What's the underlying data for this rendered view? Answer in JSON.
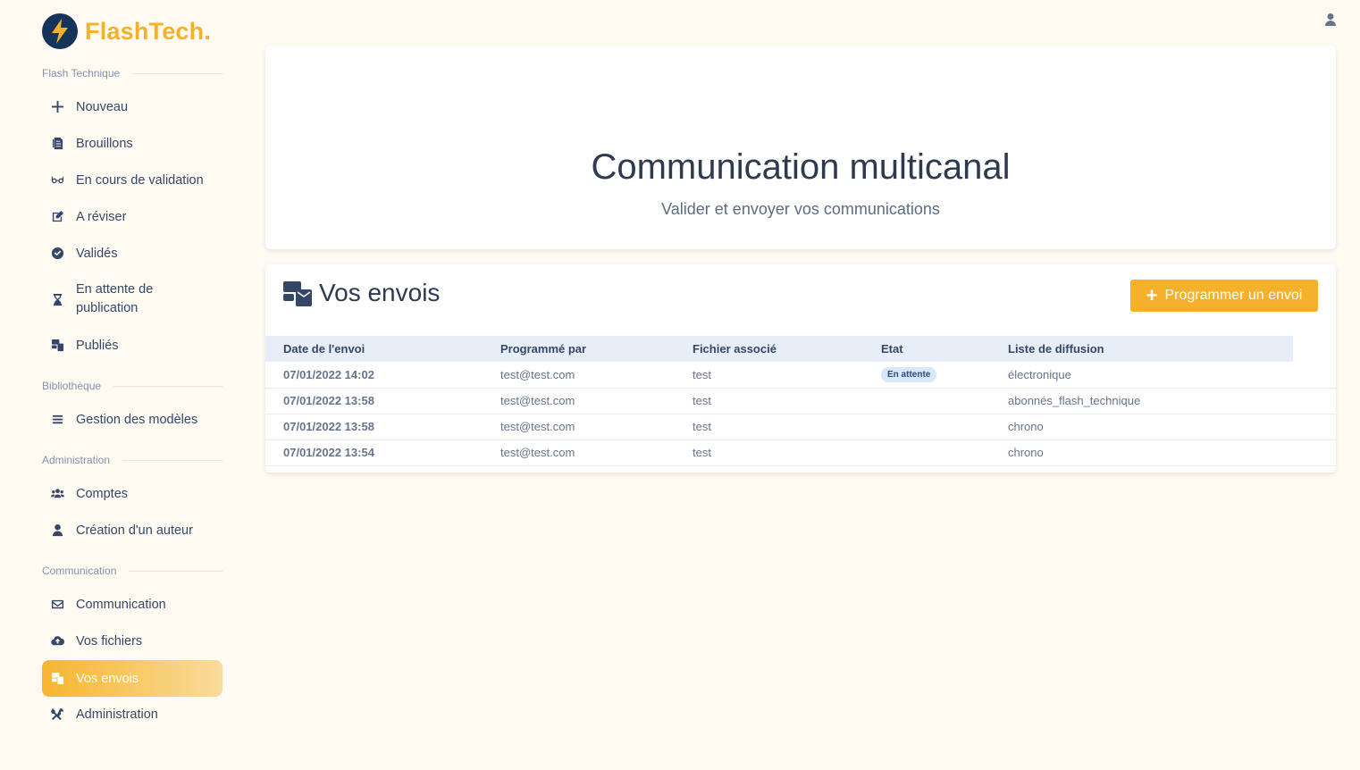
{
  "brand": {
    "name": "FlashTech."
  },
  "sidebar": {
    "sections": [
      {
        "title": "Flash Technique"
      },
      {
        "title": "Bibliothèque"
      },
      {
        "title": "Administration"
      },
      {
        "title": "Communication"
      }
    ],
    "items": [
      {
        "label": "Nouveau",
        "icon": "plus-icon"
      },
      {
        "label": "Brouillons",
        "icon": "drafts-icon"
      },
      {
        "label": "En cours de validation",
        "icon": "glasses-icon"
      },
      {
        "label": "A réviser",
        "icon": "edit-icon"
      },
      {
        "label": "Validés",
        "icon": "check-circle-icon"
      },
      {
        "label": "En attente de publication",
        "icon": "hourglass-icon"
      },
      {
        "label": "Publiés",
        "icon": "mail-bulk-icon"
      },
      {
        "label": "Gestion des modèles",
        "icon": "list-icon"
      },
      {
        "label": "Comptes",
        "icon": "users-icon"
      },
      {
        "label": "Création d'un auteur",
        "icon": "user-icon"
      },
      {
        "label": "Communication",
        "icon": "envelope-icon"
      },
      {
        "label": "Vos fichiers",
        "icon": "cloud-upload-icon"
      },
      {
        "label": "Vos envois",
        "icon": "mail-bulk-icon",
        "active": true
      },
      {
        "label": "Administration",
        "icon": "tools-icon"
      }
    ]
  },
  "hero": {
    "title": "Communication multicanal",
    "subtitle": "Valider et envoyer vos communications"
  },
  "envois": {
    "title": "Vos envois",
    "button_label": "Programmer un envoi",
    "columns": [
      "Date de l'envoi",
      "Programmé par",
      "Fichier associé",
      "Etat",
      "Liste de diffusion"
    ],
    "rows": [
      {
        "date": "07/01/2022 14:02",
        "by": "test@test.com",
        "file": "test",
        "status": "En attente",
        "list": "électronique"
      },
      {
        "date": "07/01/2022 13:58",
        "by": "test@test.com",
        "file": "test",
        "status": "",
        "list": "abonnés_flash_technique"
      },
      {
        "date": "07/01/2022 13:58",
        "by": "test@test.com",
        "file": "test",
        "status": "",
        "list": "chrono"
      },
      {
        "date": "07/01/2022 13:54",
        "by": "test@test.com",
        "file": "test",
        "status": "",
        "list": "chrono"
      }
    ]
  },
  "colors": {
    "accent": "#f6b12c",
    "background": "#fffbf3",
    "brand_dark": "#16335a",
    "badge_bg": "#d9e7fb"
  }
}
